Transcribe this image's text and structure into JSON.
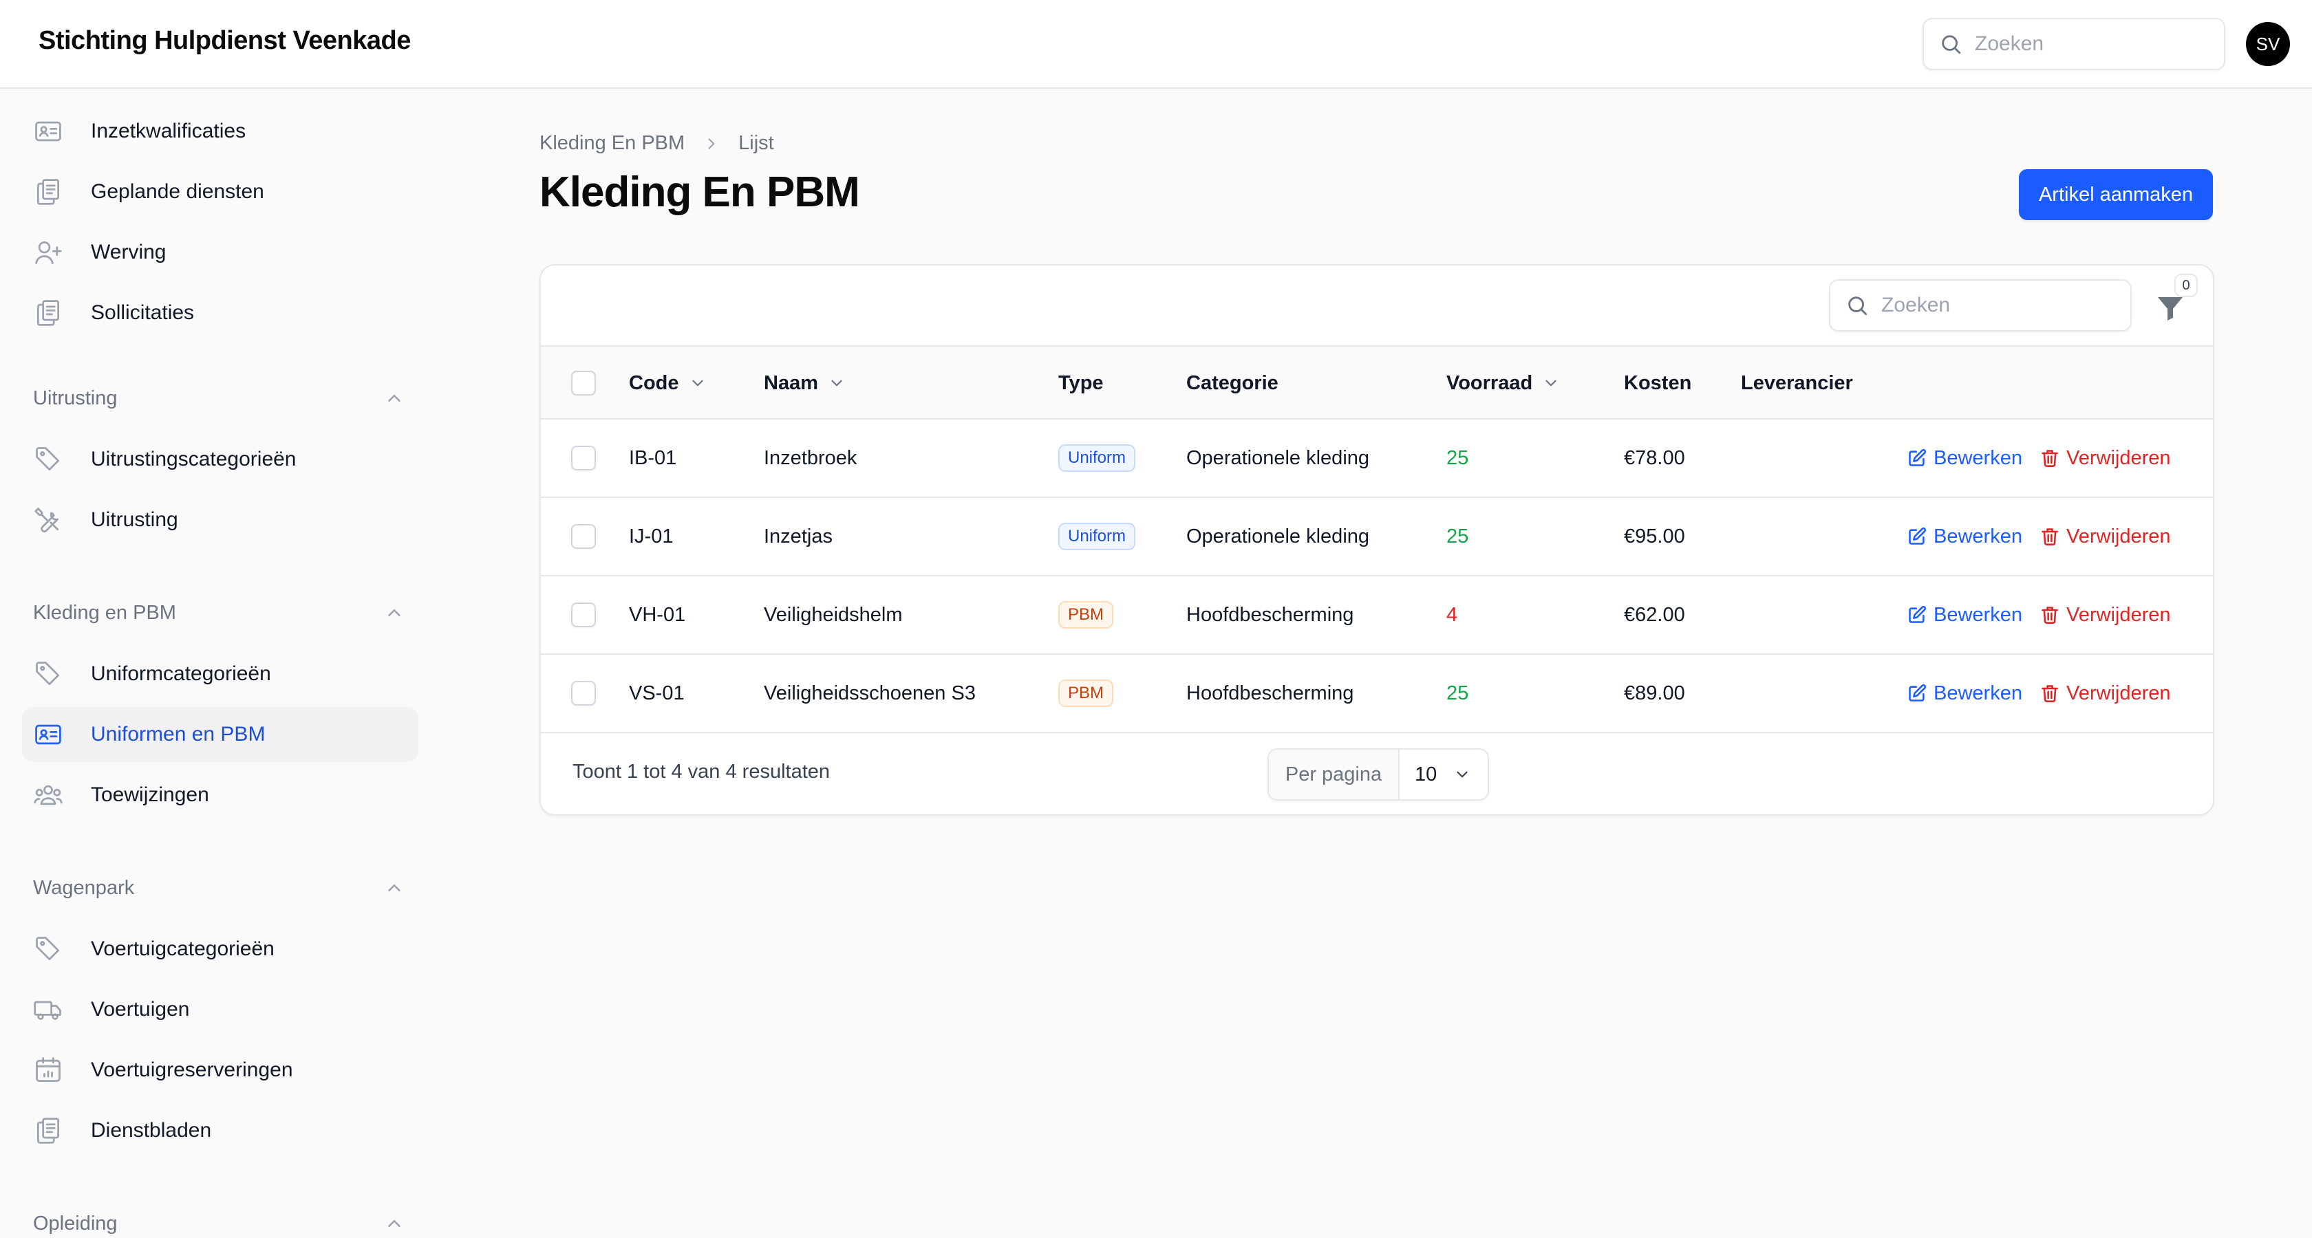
{
  "app": {
    "title": "Stichting Hulpdienst Veenkade"
  },
  "header": {
    "search_placeholder": "Zoeken",
    "avatar_initials": "SV"
  },
  "sidebar": {
    "items_top": [
      {
        "label": "Inzetkwalificaties",
        "icon": "id-card-icon"
      },
      {
        "label": "Geplande diensten",
        "icon": "clipboard-icon"
      },
      {
        "label": "Werving",
        "icon": "user-plus-icon"
      },
      {
        "label": "Sollicitaties",
        "icon": "clipboard-icon"
      }
    ],
    "groups": [
      {
        "label": "Uitrusting",
        "items": [
          {
            "label": "Uitrustingscategorieën",
            "icon": "tag-icon"
          },
          {
            "label": "Uitrusting",
            "icon": "wrench-screwdriver-icon"
          }
        ]
      },
      {
        "label": "Kleding en PBM",
        "items": [
          {
            "label": "Uniformcategorieën",
            "icon": "tag-icon"
          },
          {
            "label": "Uniformen en PBM",
            "icon": "id-card-icon",
            "active": true
          },
          {
            "label": "Toewijzingen",
            "icon": "user-group-icon"
          }
        ]
      },
      {
        "label": "Wagenpark",
        "items": [
          {
            "label": "Voertuigcategorieën",
            "icon": "tag-icon"
          },
          {
            "label": "Voertuigen",
            "icon": "truck-icon"
          },
          {
            "label": "Voertuigreserveringen",
            "icon": "calendar-icon"
          },
          {
            "label": "Dienstbladen",
            "icon": "clipboard-icon"
          }
        ]
      },
      {
        "label": "Opleiding",
        "items": []
      }
    ]
  },
  "page": {
    "breadcrumb": [
      "Kleding En PBM",
      "Lijst"
    ],
    "title": "Kleding En PBM",
    "create_button": "Artikel aanmaken"
  },
  "table": {
    "search_placeholder": "Zoeken",
    "filter_count": "0",
    "columns": {
      "code": "Code",
      "naam": "Naam",
      "type": "Type",
      "categorie": "Categorie",
      "voorraad": "Voorraad",
      "kosten": "Kosten",
      "leverancier": "Leverancier"
    },
    "actions": {
      "edit": "Bewerken",
      "delete": "Verwijderen"
    },
    "rows": [
      {
        "code": "IB-01",
        "naam": "Inzetbroek",
        "type": "Uniform",
        "categorie": "Operationele kleding",
        "voorraad": "25",
        "kosten": "€78.00",
        "leverancier": ""
      },
      {
        "code": "IJ-01",
        "naam": "Inzetjas",
        "type": "Uniform",
        "categorie": "Operationele kleding",
        "voorraad": "25",
        "kosten": "€95.00",
        "leverancier": ""
      },
      {
        "code": "VH-01",
        "naam": "Veiligheidshelm",
        "type": "PBM",
        "categorie": "Hoofdbescherming",
        "voorraad": "4",
        "kosten": "€62.00",
        "leverancier": ""
      },
      {
        "code": "VS-01",
        "naam": "Veiligheidsschoenen S3",
        "type": "PBM",
        "categorie": "Hoofdbescherming",
        "voorraad": "25",
        "kosten": "€89.00",
        "leverancier": ""
      }
    ],
    "footer": {
      "results_text": "Toont 1 tot 4 van 4 resultaten",
      "per_page_label": "Per pagina",
      "per_page_value": "10"
    }
  },
  "colors": {
    "primary": "#1a5cff",
    "stock_ok": "#16a34a",
    "stock_low": "#dc2626",
    "danger": "#dc2626"
  }
}
